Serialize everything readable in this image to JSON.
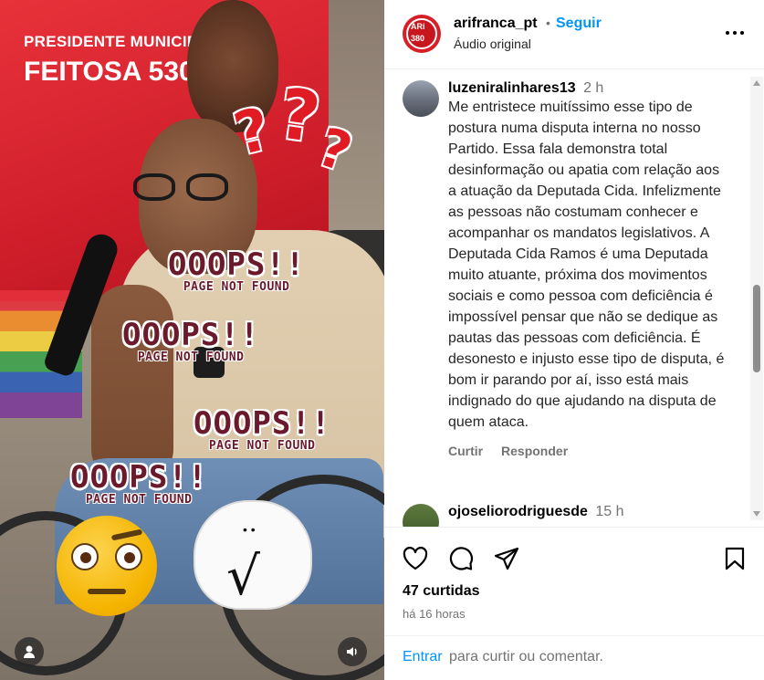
{
  "post": {
    "username": "arifranca_pt",
    "separator": "•",
    "follow_label": "Seguir",
    "audio_label": "Áudio original",
    "avatar_top": "ARi",
    "avatar_number": "380",
    "more_icon": "more-horizontal-icon"
  },
  "media": {
    "banner_line1": "PRESIDENTE MUNICIPAL",
    "banner_line2": "FEITOSA 530",
    "question_marks": [
      "?",
      "?",
      "?"
    ],
    "oops": [
      {
        "big": "OOOPS!!",
        "small": "PAGE NOT FOUND"
      },
      {
        "big": "OOOPS!!",
        "small": "PAGE NOT FOUND"
      },
      {
        "big": "OOOPS!!",
        "small": "PAGE NOT FOUND"
      },
      {
        "big": "OOOPS!!",
        "small": "PAGE NOT FOUND"
      }
    ],
    "blob_check": "√",
    "user_icon": "user-tag-icon",
    "sound_icon": "volume-icon"
  },
  "comments": [
    {
      "user": "luzeniralinhares13",
      "time": "2 h",
      "text": "Me entristece muitíssimo esse tipo de postura numa disputa interna no nosso Partido. Essa fala demonstra total desinformação ou apatia com relação aos a atuação da Deputada Cida. Infelizmente as pessoas não costumam conhecer e acompanhar os mandatos legislativos. A Deputada Cida Ramos é uma Deputada muito atuante, próxima dos movimentos sociais e como pessoa com deficiência é impossível pensar que não se dedique as pautas das pessoas com deficiência. É desonesto e injusto esse tipo de disputa, é bom ir parando por aí, isso está mais indignado do que ajudando na disputa de quem ataca.",
      "like_label": "Curtir",
      "reply_label": "Responder"
    },
    {
      "user": "ojoseliorodriguesde",
      "time": "15 h",
      "text": "",
      "like_label": "",
      "reply_label": ""
    }
  ],
  "footer": {
    "likes": "47 curtidas",
    "posted_ago": "há 16 horas",
    "enter_label": "Entrar",
    "composer_rest": "para curtir ou comentar.",
    "icons": [
      "heart-icon",
      "comment-icon",
      "share-icon",
      "bookmark-icon"
    ]
  },
  "colors": {
    "accent": "#0095f6",
    "muted": "#737373",
    "brand_red": "#d61f26"
  }
}
